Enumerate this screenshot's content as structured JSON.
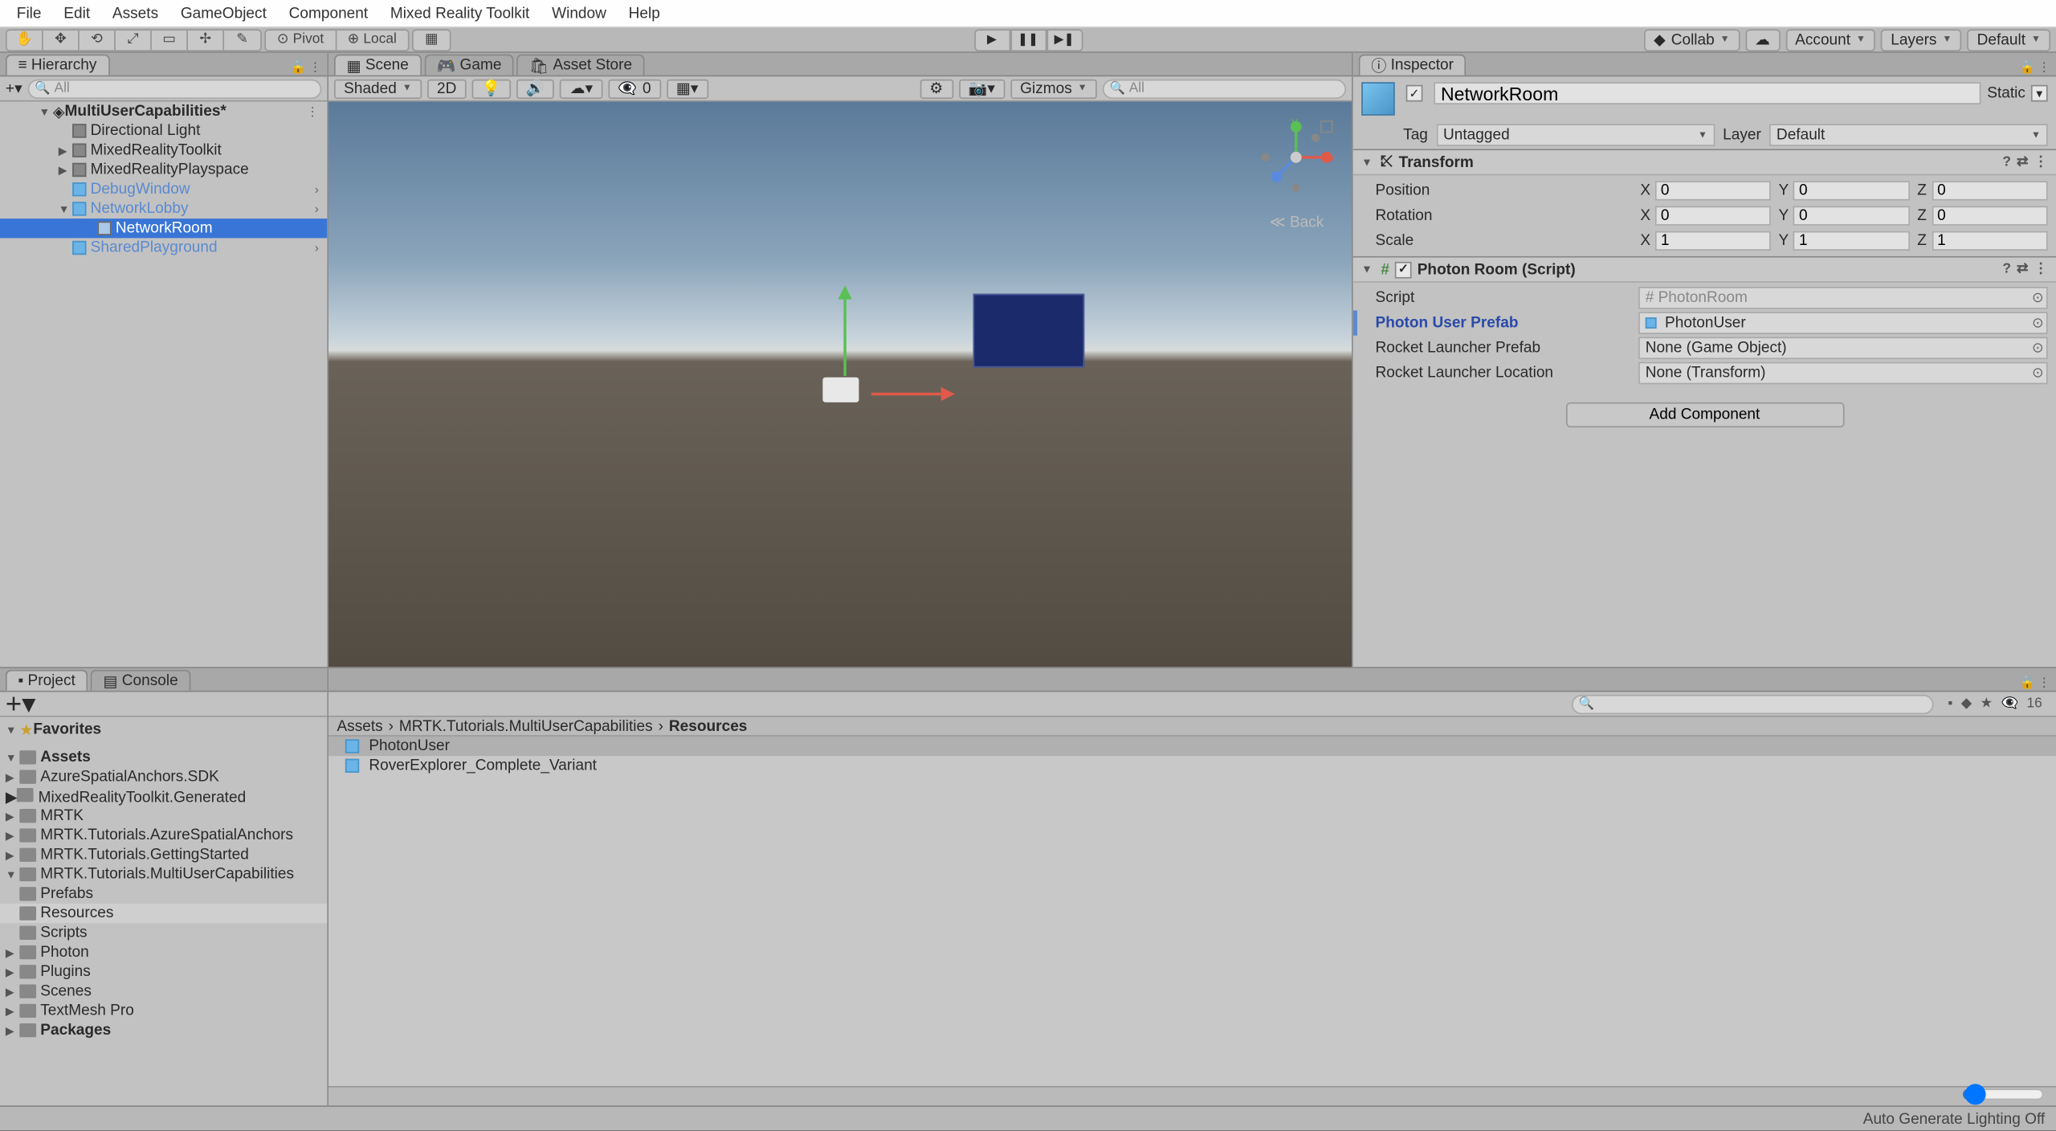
{
  "menu": [
    "File",
    "Edit",
    "Assets",
    "GameObject",
    "Component",
    "Mixed Reality Toolkit",
    "Window",
    "Help"
  ],
  "toolbar": {
    "pivot": "Pivot",
    "local": "Local",
    "collab": "Collab",
    "account": "Account",
    "layers": "Layers",
    "layout": "Default"
  },
  "hierarchy": {
    "title": "Hierarchy",
    "search_ph": "All",
    "scene": "MultiUserCapabilities*",
    "items": [
      {
        "name": "Directional Light",
        "indent": 2
      },
      {
        "name": "MixedRealityToolkit",
        "indent": 2,
        "arrow": true
      },
      {
        "name": "MixedRealityPlayspace",
        "indent": 2,
        "arrow": true
      },
      {
        "name": "DebugWindow",
        "indent": 2,
        "blue": true,
        "menu": true
      },
      {
        "name": "NetworkLobby",
        "indent": 2,
        "arrow": true,
        "open": true,
        "blue": true,
        "menu": true
      },
      {
        "name": "NetworkRoom",
        "indent": 4,
        "selected": true
      },
      {
        "name": "SharedPlayground",
        "indent": 2,
        "blue": true,
        "menu": true
      }
    ]
  },
  "scene_tabs": {
    "scene": "Scene",
    "game": "Game",
    "asset_store": "Asset Store"
  },
  "scene_toolbar": {
    "shaded": "Shaded",
    "twod": "2D",
    "gizmos": "Gizmos",
    "search_ph": "All",
    "hidden": "0"
  },
  "scene_back": "Back",
  "inspector": {
    "title": "Inspector",
    "name": "NetworkRoom",
    "static": "Static",
    "tag_label": "Tag",
    "tag_value": "Untagged",
    "layer_label": "Layer",
    "layer_value": "Default",
    "transform": {
      "title": "Transform",
      "position": "Position",
      "rotation": "Rotation",
      "scale": "Scale",
      "px": "0",
      "py": "0",
      "pz": "0",
      "rx": "0",
      "ry": "0",
      "rz": "0",
      "sx": "1",
      "sy": "1",
      "sz": "1"
    },
    "photon": {
      "title": "Photon Room (Script)",
      "script_label": "Script",
      "script_value": "PhotonRoom",
      "prefab_label": "Photon User Prefab",
      "prefab_value": "PhotonUser",
      "rocket_prefab_label": "Rocket Launcher Prefab",
      "rocket_prefab_value": "None (Game Object)",
      "rocket_loc_label": "Rocket Launcher Location",
      "rocket_loc_value": "None (Transform)"
    },
    "add_component": "Add Component"
  },
  "project": {
    "title": "Project",
    "console": "Console",
    "favorites": "Favorites",
    "assets": "Assets",
    "packages": "Packages",
    "folders": [
      "AzureSpatialAnchors.SDK",
      "MixedRealityToolkit.Generated",
      "MRTK",
      "MRTK.Tutorials.AzureSpatialAnchors",
      "MRTK.Tutorials.GettingStarted",
      "MRTK.Tutorials.MultiUserCapabilities"
    ],
    "subfolders": [
      "Prefabs",
      "Resources",
      "Scripts"
    ],
    "folders2": [
      "Photon",
      "Plugins",
      "Scenes",
      "TextMesh Pro"
    ],
    "breadcrumb": [
      "Assets",
      "MRTK.Tutorials.MultiUserCapabilities",
      "Resources"
    ],
    "assets_list": [
      "PhotonUser",
      "RoverExplorer_Complete_Variant"
    ],
    "slider_count": "16"
  },
  "status": "Auto Generate Lighting Off"
}
